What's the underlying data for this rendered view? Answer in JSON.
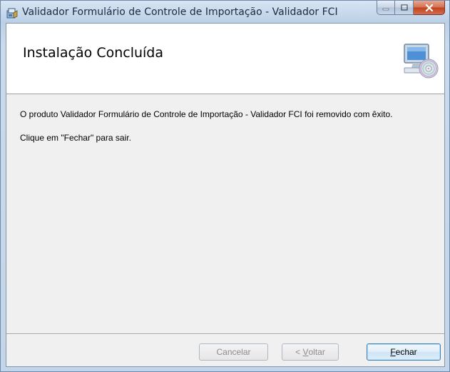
{
  "window": {
    "title": "Validador Formulário de Controle de Importação - Validador FCI",
    "app_icon": "installer-icon",
    "controls": {
      "minimize": "minimize-icon",
      "maximize": "maximize-icon",
      "close": "close-icon"
    }
  },
  "banner": {
    "title": "Instalação Concluída",
    "icon": "computer-cd-icon"
  },
  "messages": {
    "removed": "O produto Validador Formulário de Controle de Importação - Validador FCI foi removido com êxito.",
    "exit_hint": "Clique em \"Fechar\" para sair."
  },
  "buttons": {
    "cancel": "Cancelar",
    "back_prefix": "< ",
    "back_mnemonic": "V",
    "back_rest": "oltar",
    "close_mnemonic": "F",
    "close_rest": "echar",
    "cancel_enabled": false,
    "back_enabled": false,
    "close_enabled": true
  },
  "colors": {
    "title_text": "#1b2b3c",
    "disabled_text": "#8d8d8d",
    "close_button": "#c0411d"
  }
}
